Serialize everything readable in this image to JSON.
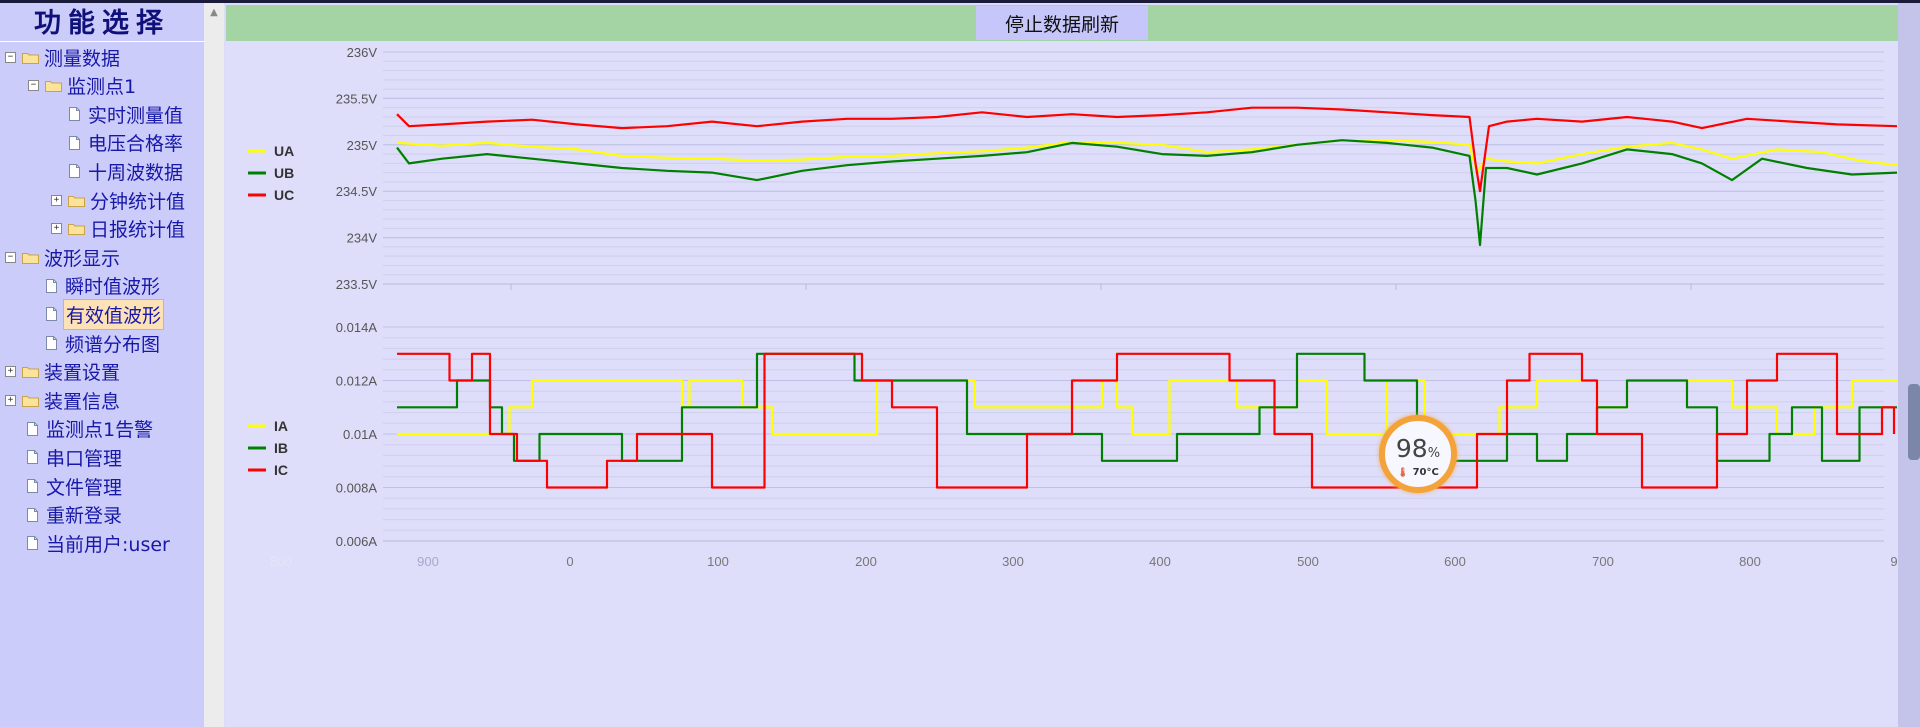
{
  "sidebar": {
    "title": "功能选择",
    "items": [
      {
        "label": "测量数据",
        "type": "folder",
        "toggle": "−",
        "level": 0
      },
      {
        "label": "监测点1",
        "type": "folder",
        "toggle": "−",
        "level": 1
      },
      {
        "label": "实时测量值",
        "type": "doc",
        "toggle": "",
        "level": 2
      },
      {
        "label": "电压合格率",
        "type": "doc",
        "toggle": "",
        "level": 2
      },
      {
        "label": "十周波数据",
        "type": "doc",
        "toggle": "",
        "level": 2
      },
      {
        "label": "分钟统计值",
        "type": "folder",
        "toggle": "+",
        "level": 2
      },
      {
        "label": "日报统计值",
        "type": "folder",
        "toggle": "+",
        "level": 2
      },
      {
        "label": "波形显示",
        "type": "folder",
        "toggle": "−",
        "level": 0
      },
      {
        "label": "瞬时值波形",
        "type": "doc",
        "toggle": "",
        "level": 1
      },
      {
        "label": "有效值波形",
        "type": "doc",
        "toggle": "",
        "level": 1,
        "selected": true
      },
      {
        "label": "频谱分布图",
        "type": "doc",
        "toggle": "",
        "level": 1
      },
      {
        "label": "装置设置",
        "type": "folder",
        "toggle": "+",
        "level": 0
      },
      {
        "label": "装置信息",
        "type": "folder",
        "toggle": "+",
        "level": 0
      },
      {
        "label": "监测点1告警",
        "type": "doc",
        "toggle": "",
        "level": 0
      },
      {
        "label": "串口管理",
        "type": "doc",
        "toggle": "",
        "level": 0
      },
      {
        "label": "文件管理",
        "type": "doc",
        "toggle": "",
        "level": 0
      },
      {
        "label": "重新登录",
        "type": "doc",
        "toggle": "",
        "level": 0
      },
      {
        "label": "当前用户:user",
        "type": "doc",
        "toggle": "",
        "level": 0
      }
    ]
  },
  "header": {
    "refresh_button": "停止数据刷新"
  },
  "cpu_badge": {
    "value": "98",
    "unit": "%",
    "temp": "70°C"
  },
  "colors": {
    "UA": "#ffff00",
    "UB": "#008000",
    "UC": "#ff0000",
    "header_bg": "#a4d4a4",
    "sidebar_bg": "#ccccfa"
  },
  "chart_data": [
    {
      "type": "line",
      "title": "",
      "xlabel": "",
      "ylabel": "",
      "ylim": [
        233.5,
        236
      ],
      "y_ticks": [
        "233.5V",
        "234V",
        "234.5V",
        "235V",
        "235.5V",
        "236V"
      ],
      "legend_position": "left",
      "grid": true,
      "x_range": [
        0,
        1000
      ],
      "series": [
        {
          "name": "UA",
          "color": "#ffff00",
          "points": [
            [
              0,
              235.02
            ],
            [
              30,
              234.99
            ],
            [
              60,
              235.02
            ],
            [
              90,
              234.98
            ],
            [
              120,
              234.95
            ],
            [
              150,
              234.88
            ],
            [
              180,
              234.86
            ],
            [
              210,
              234.85
            ],
            [
              240,
              234.83
            ],
            [
              270,
              234.84
            ],
            [
              300,
              234.87
            ],
            [
              330,
              234.88
            ],
            [
              360,
              234.91
            ],
            [
              390,
              234.93
            ],
            [
              420,
              234.97
            ],
            [
              450,
              235.03
            ],
            [
              480,
              235.02
            ],
            [
              510,
              235.0
            ],
            [
              540,
              234.92
            ],
            [
              570,
              234.95
            ],
            [
              600,
              235.0
            ],
            [
              630,
              235.05
            ],
            [
              660,
              235.05
            ],
            [
              690,
              235.03
            ],
            [
              715,
              235.0
            ],
            [
              720,
              234.7
            ],
            [
              726,
              234.85
            ],
            [
              740,
              234.82
            ],
            [
              760,
              234.8
            ],
            [
              790,
              234.9
            ],
            [
              820,
              234.98
            ],
            [
              850,
              235.02
            ],
            [
              870,
              234.95
            ],
            [
              890,
              234.85
            ],
            [
              920,
              234.95
            ],
            [
              950,
              234.92
            ],
            [
              975,
              234.83
            ],
            [
              1000,
              234.78
            ]
          ]
        },
        {
          "name": "UB",
          "color": "#008000",
          "points": [
            [
              0,
              234.97
            ],
            [
              8,
              234.8
            ],
            [
              30,
              234.85
            ],
            [
              60,
              234.9
            ],
            [
              90,
              234.85
            ],
            [
              120,
              234.8
            ],
            [
              150,
              234.75
            ],
            [
              180,
              234.72
            ],
            [
              210,
              234.7
            ],
            [
              240,
              234.62
            ],
            [
              270,
              234.72
            ],
            [
              300,
              234.78
            ],
            [
              330,
              234.82
            ],
            [
              360,
              234.85
            ],
            [
              390,
              234.88
            ],
            [
              420,
              234.92
            ],
            [
              450,
              235.02
            ],
            [
              480,
              234.98
            ],
            [
              510,
              234.9
            ],
            [
              540,
              234.88
            ],
            [
              570,
              234.92
            ],
            [
              600,
              235.0
            ],
            [
              630,
              235.05
            ],
            [
              660,
              235.02
            ],
            [
              690,
              234.97
            ],
            [
              715,
              234.88
            ],
            [
              719,
              234.4
            ],
            [
              722,
              233.92
            ],
            [
              726,
              234.75
            ],
            [
              740,
              234.75
            ],
            [
              760,
              234.68
            ],
            [
              790,
              234.8
            ],
            [
              820,
              234.95
            ],
            [
              850,
              234.9
            ],
            [
              870,
              234.8
            ],
            [
              890,
              234.62
            ],
            [
              910,
              234.85
            ],
            [
              940,
              234.75
            ],
            [
              970,
              234.68
            ],
            [
              1000,
              234.7
            ]
          ]
        },
        {
          "name": "UC",
          "color": "#ff0000",
          "points": [
            [
              0,
              235.33
            ],
            [
              8,
              235.2
            ],
            [
              30,
              235.22
            ],
            [
              60,
              235.25
            ],
            [
              90,
              235.27
            ],
            [
              120,
              235.22
            ],
            [
              150,
              235.18
            ],
            [
              180,
              235.2
            ],
            [
              210,
              235.25
            ],
            [
              240,
              235.2
            ],
            [
              270,
              235.25
            ],
            [
              300,
              235.28
            ],
            [
              330,
              235.28
            ],
            [
              360,
              235.3
            ],
            [
              390,
              235.35
            ],
            [
              420,
              235.3
            ],
            [
              450,
              235.33
            ],
            [
              480,
              235.3
            ],
            [
              510,
              235.32
            ],
            [
              540,
              235.35
            ],
            [
              570,
              235.4
            ],
            [
              600,
              235.4
            ],
            [
              630,
              235.38
            ],
            [
              660,
              235.35
            ],
            [
              690,
              235.32
            ],
            [
              715,
              235.3
            ],
            [
              719,
              234.8
            ],
            [
              722,
              234.5
            ],
            [
              728,
              235.2
            ],
            [
              740,
              235.25
            ],
            [
              760,
              235.28
            ],
            [
              790,
              235.25
            ],
            [
              820,
              235.3
            ],
            [
              850,
              235.25
            ],
            [
              870,
              235.18
            ],
            [
              900,
              235.28
            ],
            [
              930,
              235.25
            ],
            [
              960,
              235.22
            ],
            [
              1000,
              235.2
            ]
          ]
        }
      ]
    },
    {
      "type": "line",
      "title": "",
      "xlabel": "",
      "ylabel": "",
      "ylim": [
        0.006,
        0.014
      ],
      "y_ticks": [
        "0.006A",
        "0.008A",
        "0.01A",
        "0.012A",
        "0.014A"
      ],
      "x_ticks": [
        900,
        0,
        100,
        200,
        300,
        400,
        500,
        600,
        700,
        800,
        9
      ],
      "x_ticks_faint": [
        800
      ],
      "legend_position": "left",
      "grid": true,
      "x_range": [
        0,
        1000
      ],
      "series": [
        {
          "name": "IA",
          "color": "#ffff00",
          "steps": [
            [
              0,
              0.01
            ],
            [
              75,
              0.011
            ],
            [
              90,
              0.012
            ],
            [
              190,
              0.011
            ],
            [
              195,
              0.012
            ],
            [
              230,
              0.011
            ],
            [
              250,
              0.01
            ],
            [
              320,
              0.012
            ],
            [
              385,
              0.011
            ],
            [
              470,
              0.012
            ],
            [
              480,
              0.011
            ],
            [
              490,
              0.01
            ],
            [
              515,
              0.012
            ],
            [
              560,
              0.011
            ],
            [
              600,
              0.012
            ],
            [
              620,
              0.01
            ],
            [
              660,
              0.012
            ],
            [
              685,
              0.01
            ],
            [
              735,
              0.011
            ],
            [
              760,
              0.012
            ],
            [
              800,
              0.011
            ],
            [
              820,
              0.012
            ],
            [
              890,
              0.011
            ],
            [
              920,
              0.01
            ],
            [
              945,
              0.011
            ],
            [
              970,
              0.012
            ],
            [
              1000,
              0.012
            ]
          ]
        },
        {
          "name": "IB",
          "color": "#008000",
          "steps": [
            [
              0,
              0.011
            ],
            [
              40,
              0.012
            ],
            [
              62,
              0.011
            ],
            [
              70,
              0.01
            ],
            [
              78,
              0.009
            ],
            [
              95,
              0.01
            ],
            [
              150,
              0.009
            ],
            [
              190,
              0.011
            ],
            [
              240,
              0.013
            ],
            [
              305,
              0.012
            ],
            [
              380,
              0.01
            ],
            [
              470,
              0.009
            ],
            [
              520,
              0.01
            ],
            [
              575,
              0.011
            ],
            [
              600,
              0.013
            ],
            [
              645,
              0.012
            ],
            [
              680,
              0.01
            ],
            [
              700,
              0.009
            ],
            [
              740,
              0.01
            ],
            [
              760,
              0.009
            ],
            [
              780,
              0.01
            ],
            [
              800,
              0.011
            ],
            [
              820,
              0.012
            ],
            [
              860,
              0.011
            ],
            [
              880,
              0.009
            ],
            [
              915,
              0.01
            ],
            [
              930,
              0.011
            ],
            [
              950,
              0.009
            ],
            [
              975,
              0.011
            ],
            [
              1000,
              0.011
            ]
          ]
        },
        {
          "name": "IC",
          "color": "#ff0000",
          "steps": [
            [
              0,
              0.013
            ],
            [
              35,
              0.012
            ],
            [
              50,
              0.013
            ],
            [
              62,
              0.01
            ],
            [
              80,
              0.009
            ],
            [
              100,
              0.008
            ],
            [
              140,
              0.009
            ],
            [
              160,
              0.01
            ],
            [
              210,
              0.008
            ],
            [
              245,
              0.013
            ],
            [
              310,
              0.012
            ],
            [
              330,
              0.011
            ],
            [
              360,
              0.008
            ],
            [
              420,
              0.01
            ],
            [
              450,
              0.012
            ],
            [
              480,
              0.013
            ],
            [
              555,
              0.012
            ],
            [
              585,
              0.01
            ],
            [
              610,
              0.008
            ],
            [
              720,
              0.01
            ],
            [
              740,
              0.012
            ],
            [
              755,
              0.013
            ],
            [
              790,
              0.012
            ],
            [
              800,
              0.01
            ],
            [
              830,
              0.008
            ],
            [
              880,
              0.01
            ],
            [
              900,
              0.012
            ],
            [
              920,
              0.013
            ],
            [
              960,
              0.01
            ],
            [
              990,
              0.011
            ],
            [
              998,
              0.01
            ]
          ]
        }
      ]
    }
  ]
}
